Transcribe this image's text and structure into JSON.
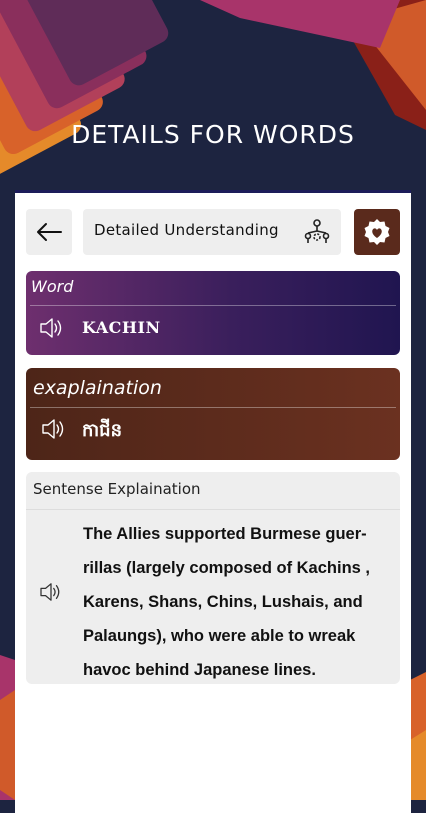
{
  "header": {
    "title": "DETAILS FOR WORDS"
  },
  "toolbar": {
    "back_icon": "arrow-left-icon",
    "search_value": "Detailed Understanding",
    "detail_icon": "hierarchy-people-icon",
    "favorite_icon": "heart-badge-icon"
  },
  "word": {
    "label": "Word",
    "value": "KACHIN",
    "speaker_icon": "speaker-icon"
  },
  "explanation": {
    "label": "exaplaination",
    "value": "កាជីន",
    "speaker_icon": "speaker-icon"
  },
  "sentence": {
    "label": "Sentense Explaination",
    "speaker_icon": "speaker-icon",
    "text": "The Allies supported Burmese guer-rillas (largely composed of Kachins , Karens, Shans, Chins, Lushais, and Palaungs), who were able to wreak havoc behind Japanese lines."
  },
  "colors": {
    "background": "#1d2440",
    "word_gradient": [
      "#6e2f6e",
      "#201550"
    ],
    "explanation_gradient": [
      "#4d2518",
      "#6b3120"
    ],
    "favorite_button": "#5a2a1c"
  }
}
